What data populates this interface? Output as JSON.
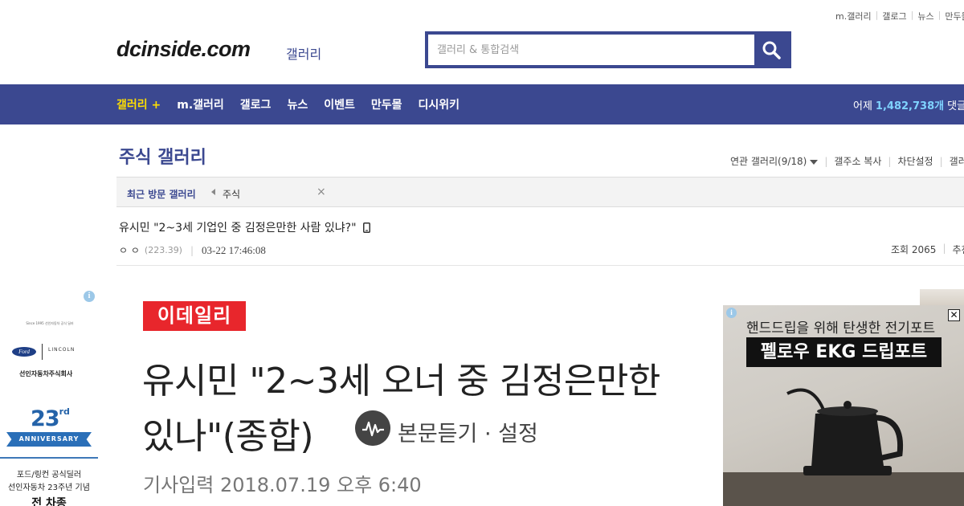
{
  "top_links": [
    "m.갤러리",
    "갤로그",
    "뉴스",
    "만두몰"
  ],
  "header": {
    "logo": "dcinside.com",
    "logo_sub": "갤러리",
    "search_placeholder": "갤러리 & 통합검색"
  },
  "nav": {
    "items": [
      "갤러리 +",
      "m.갤러리",
      "갤로그",
      "뉴스",
      "이벤트",
      "만두몰",
      "디시위키"
    ],
    "stats_label": "어제",
    "stats_count": "1,482,738개",
    "stats_suffix": "댓글"
  },
  "gallery": {
    "title": "주식 갤러리",
    "related": "연관 갤러리(9/18)",
    "tools": [
      "갤주소 복사",
      "차단설정",
      "갤러리"
    ]
  },
  "recent": {
    "label": "최근 방문 갤러리",
    "item": "주식"
  },
  "post": {
    "title": "유시민 \"2~3세 기업인 중 김정은만한 사람 있냐?\"",
    "author": "ㅇ ㅇ",
    "ip": "(223.39)",
    "date": "03-22 17:46:08",
    "views": "조회 2065",
    "recommend": "추천"
  },
  "article": {
    "brand": "이데일리",
    "headline_line1": "유시민 \"2~3세 오너 중 김정은만한",
    "headline_line2": "있나\"(종합)",
    "tts_label": "본문듣기 · 설정",
    "date_line": "기사입력  2018.07.19 오후 6:40"
  },
  "left_ad": {
    "info": "i",
    "tiny_text": "Since 1995 선인자동차 공식 딜러",
    "ford": "Ford",
    "lincoln": "LINCOLN",
    "dealer": "선인자동차주식회사",
    "anniv_number": "23",
    "anniv_suffix": "rd",
    "anniv_ribbon": "ANNIVERSARY",
    "line1": "포드/링컨 공식딜러",
    "line2": "선인자동차 23주년 기념",
    "line3": "전 차종"
  },
  "right_ad": {
    "info": "i",
    "close": "✕",
    "copy": "핸드드립을 위해 탄생한 전기포트",
    "product": "펠로우 EKG 드립포트"
  },
  "colors": {
    "brand_blue": "#3b4890",
    "nav_active": "#ffde00",
    "stats_highlight": "#7fd3ff",
    "news_red": "#e8262c"
  }
}
